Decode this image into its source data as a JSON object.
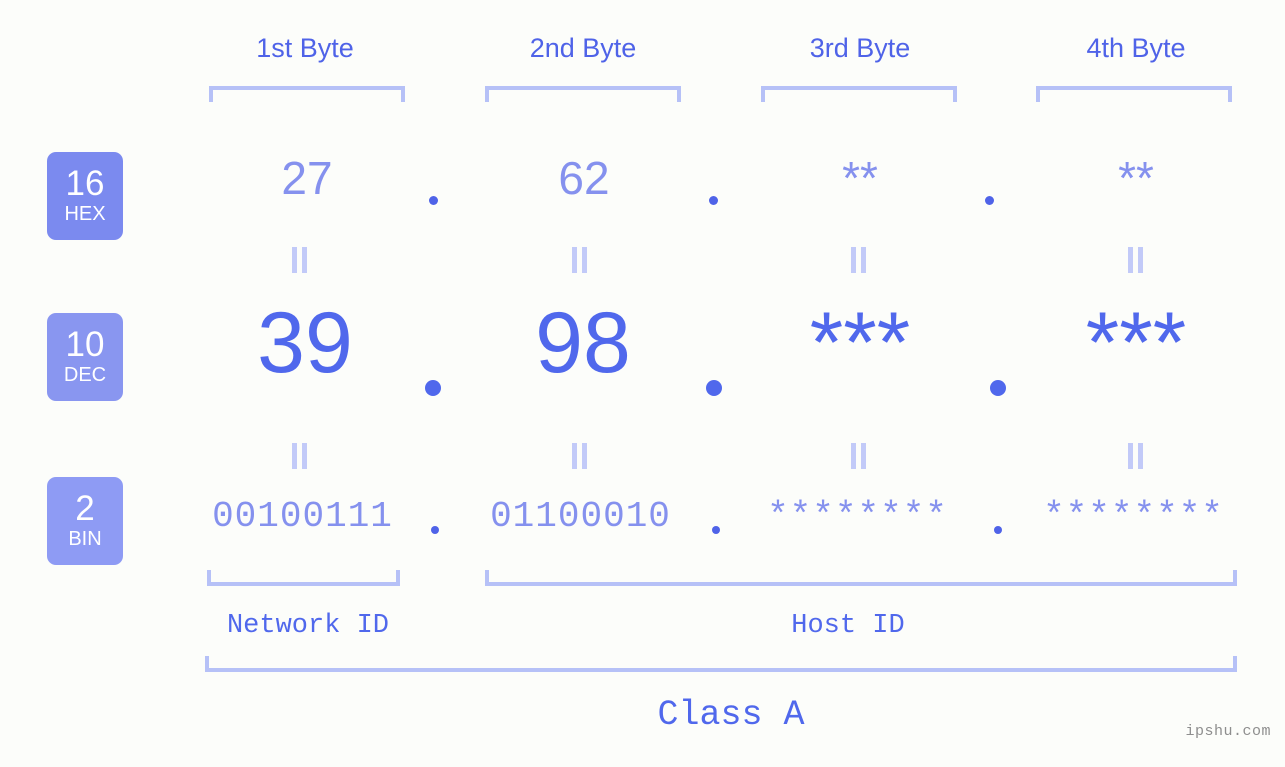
{
  "background_color": "#fcfdfa",
  "accent_color": "#5068ec",
  "accent_light_color": "#8591ee",
  "bracket_color": "#b6c1f7",
  "eq_mark_color": "#c2caf8",
  "header": {
    "byte_labels": [
      "1st Byte",
      "2nd Byte",
      "3rd Byte",
      "4th Byte"
    ]
  },
  "radix_badges": [
    {
      "number": "16",
      "name": "HEX",
      "color": "#7b8aef"
    },
    {
      "number": "10",
      "name": "DEC",
      "color": "#8996f0"
    },
    {
      "number": "2",
      "name": "BIN",
      "color": "#8e9bf4"
    }
  ],
  "rows": {
    "hex": {
      "values": [
        "27",
        "62",
        "**",
        "**"
      ],
      "separator": "."
    },
    "dec": {
      "values": [
        "39",
        "98",
        "***",
        "***"
      ],
      "separator": "."
    },
    "bin": {
      "values": [
        "00100111",
        "01100010",
        "********",
        "********"
      ],
      "separator": "."
    }
  },
  "equality_marks": {
    "glyph": "||",
    "rows": 2,
    "columns": 4
  },
  "footer": {
    "network_id_label": "Network ID",
    "host_id_label": "Host ID",
    "class_label": "Class A"
  },
  "watermark": "ipshu.com"
}
